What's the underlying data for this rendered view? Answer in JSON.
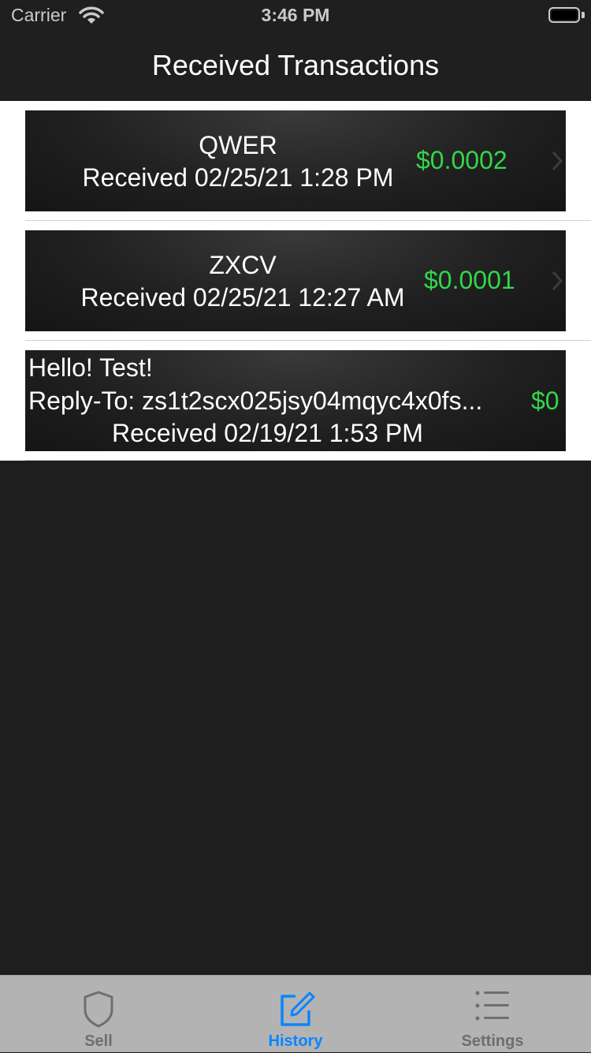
{
  "status_bar": {
    "carrier": "Carrier",
    "time": "3:46 PM"
  },
  "nav": {
    "title": "Received Transactions"
  },
  "transactions": [
    {
      "memo": "QWER",
      "date": "Received 02/25/21 1:28 PM",
      "amount": "$0.0002"
    },
    {
      "memo": "ZXCV",
      "date": "Received 02/25/21 12:27 AM",
      "amount": "$0.0001"
    },
    {
      "memo": "Hello! Test!",
      "reply_to": "Reply-To: zs1t2scx025jsy04mqyc4x0fs...",
      "date": "Received 02/19/21 1:53 PM",
      "amount": "$0"
    }
  ],
  "tabs": [
    {
      "label": "Sell",
      "icon": "shield-icon",
      "active": false
    },
    {
      "label": "History",
      "icon": "compose-icon",
      "active": true
    },
    {
      "label": "Settings",
      "icon": "list-icon",
      "active": false
    }
  ],
  "colors": {
    "accent": "#0a84ff",
    "amount": "#32d74b",
    "tab_inactive": "#6e6e73"
  }
}
